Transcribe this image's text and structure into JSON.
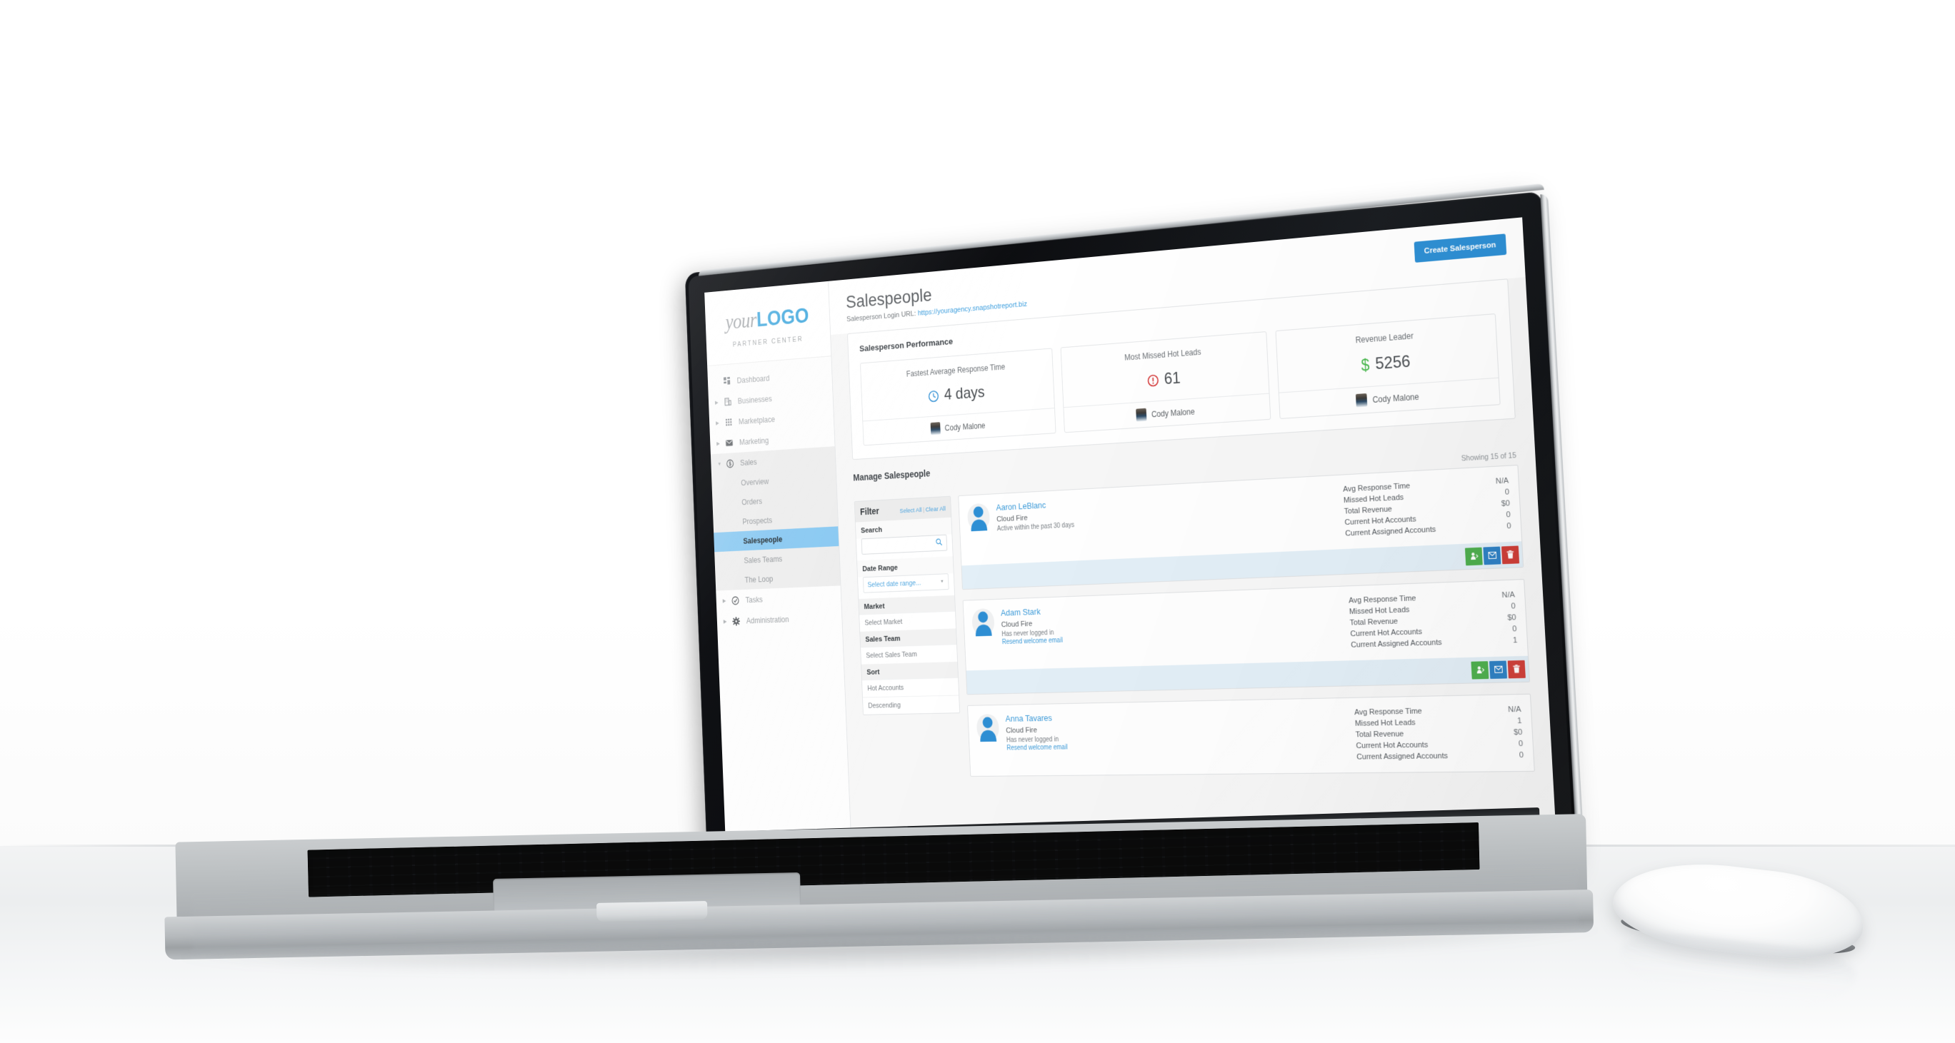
{
  "sidebar": {
    "logo": {
      "prefix": "your",
      "main": "LOGO",
      "subtitle": "PARTNER CENTER"
    },
    "items": [
      {
        "label": "Dashboard",
        "icon": "grid-icon",
        "expandable": false
      },
      {
        "label": "Businesses",
        "icon": "building-icon",
        "expandable": true
      },
      {
        "label": "Marketplace",
        "icon": "dots-grid-icon",
        "expandable": true
      },
      {
        "label": "Marketing",
        "icon": "envelope-icon",
        "expandable": true
      },
      {
        "label": "Sales",
        "icon": "dollar-circle-icon",
        "expandable": true,
        "expanded": true
      },
      {
        "label": "Tasks",
        "icon": "check-circle-icon",
        "expandable": true
      },
      {
        "label": "Administration",
        "icon": "gear-icon",
        "expandable": true
      }
    ],
    "sales_subitems": [
      {
        "label": "Overview",
        "active": false
      },
      {
        "label": "Orders",
        "active": false
      },
      {
        "label": "Prospects",
        "active": false
      },
      {
        "label": "Salespeople",
        "active": true
      },
      {
        "label": "Sales Teams",
        "active": false
      },
      {
        "label": "The Loop",
        "active": false
      }
    ]
  },
  "header": {
    "title": "Salespeople",
    "login_url_label": "Salesperson Login URL:",
    "login_url": "https://youragency.snapshotreport.biz",
    "create_button": "Create Salesperson"
  },
  "performance": {
    "section_title": "Salesperson Performance",
    "cards": [
      {
        "label": "Fastest Average Response Time",
        "value": "4 days",
        "icon": "clock-icon",
        "person": "Cody Malone"
      },
      {
        "label": "Most Missed Hot Leads",
        "value": "61",
        "icon": "alert-circle-icon",
        "person": "Cody Malone"
      },
      {
        "label": "Revenue Leader",
        "value": "5256",
        "icon": "dollar-icon",
        "person": "Cody Malone"
      }
    ]
  },
  "manage": {
    "title": "Manage Salespeople",
    "showing": "Showing 15 of 15"
  },
  "filter": {
    "title": "Filter",
    "select_all": "Select All",
    "clear_all": "Clear All",
    "search_label": "Search",
    "search_value": "",
    "search_placeholder": "",
    "date_label": "Date Range",
    "date_value": "Select date range...",
    "market_label": "Market",
    "market_value": "Select Market",
    "team_label": "Sales Team",
    "team_value": "Select Sales Team",
    "sort_label": "Sort",
    "sort_field": "Hot Accounts",
    "sort_dir": "Descending"
  },
  "metric_labels": {
    "response": "Avg Response Time",
    "missed": "Missed Hot Leads",
    "revenue": "Total Revenue",
    "hot": "Current Hot Accounts",
    "assigned": "Current Assigned Accounts"
  },
  "actions": {
    "assign": "assign-accounts",
    "email": "send-email",
    "delete": "delete-salesperson"
  },
  "salespeople": [
    {
      "name": "Aaron LeBlanc",
      "company": "Cloud Fire",
      "status": "Active within the past 30 days",
      "resend_link": null,
      "response": "N/A",
      "missed": "0",
      "revenue": "$0",
      "hot": "0",
      "assigned": "0"
    },
    {
      "name": "Adam Stark",
      "company": "Cloud Fire",
      "status": "Has never logged in",
      "resend_link": "Resend welcome email",
      "response": "N/A",
      "missed": "0",
      "revenue": "$0",
      "hot": "0",
      "assigned": "1"
    },
    {
      "name": "Anna Tavares",
      "company": "Cloud Fire",
      "status": "Has never logged in",
      "resend_link": "Resend welcome email",
      "response": "N/A",
      "missed": "1",
      "revenue": "$0",
      "hot": "0",
      "assigned": "0"
    }
  ],
  "colors": {
    "accent_blue": "#2e8fd4",
    "link_blue": "#3c9bd9",
    "logo_blue": "#35a3dc",
    "active_highlight": "#87c8f2",
    "green": "#4cae4c",
    "red": "#cf3b35",
    "revenue_green": "#49b94e"
  }
}
